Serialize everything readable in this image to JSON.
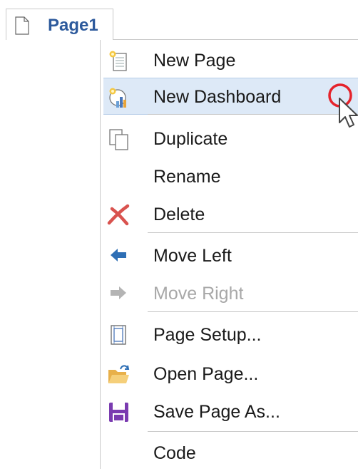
{
  "tab": {
    "label": "Page1",
    "icon": "document-icon"
  },
  "menu": {
    "items": [
      {
        "label": "New Page",
        "icon": "new-page-icon"
      },
      {
        "label": "New Dashboard",
        "icon": "new-dashboard-icon",
        "highlighted": true
      },
      {
        "label": "Duplicate",
        "icon": "duplicate-icon"
      },
      {
        "label": "Rename",
        "icon": ""
      },
      {
        "label": "Delete",
        "icon": "delete-icon",
        "color": "#d9534f"
      },
      {
        "label": "Move Left",
        "icon": "arrow-left-icon",
        "color": "#2e6fb5"
      },
      {
        "label": "Move Right",
        "icon": "arrow-right-icon",
        "disabled": true
      },
      {
        "label": "Page Setup...",
        "icon": "page-setup-icon"
      },
      {
        "label": "Open Page...",
        "icon": "open-folder-icon",
        "color": "#e8b04a"
      },
      {
        "label": "Save Page As...",
        "icon": "save-icon",
        "color": "#7a3bb0"
      },
      {
        "label": "Code",
        "icon": ""
      }
    ]
  },
  "colors": {
    "tab_text": "#2d5a9c",
    "highlight_bg": "#dde9f7",
    "cursor_ring": "#e5232b"
  }
}
